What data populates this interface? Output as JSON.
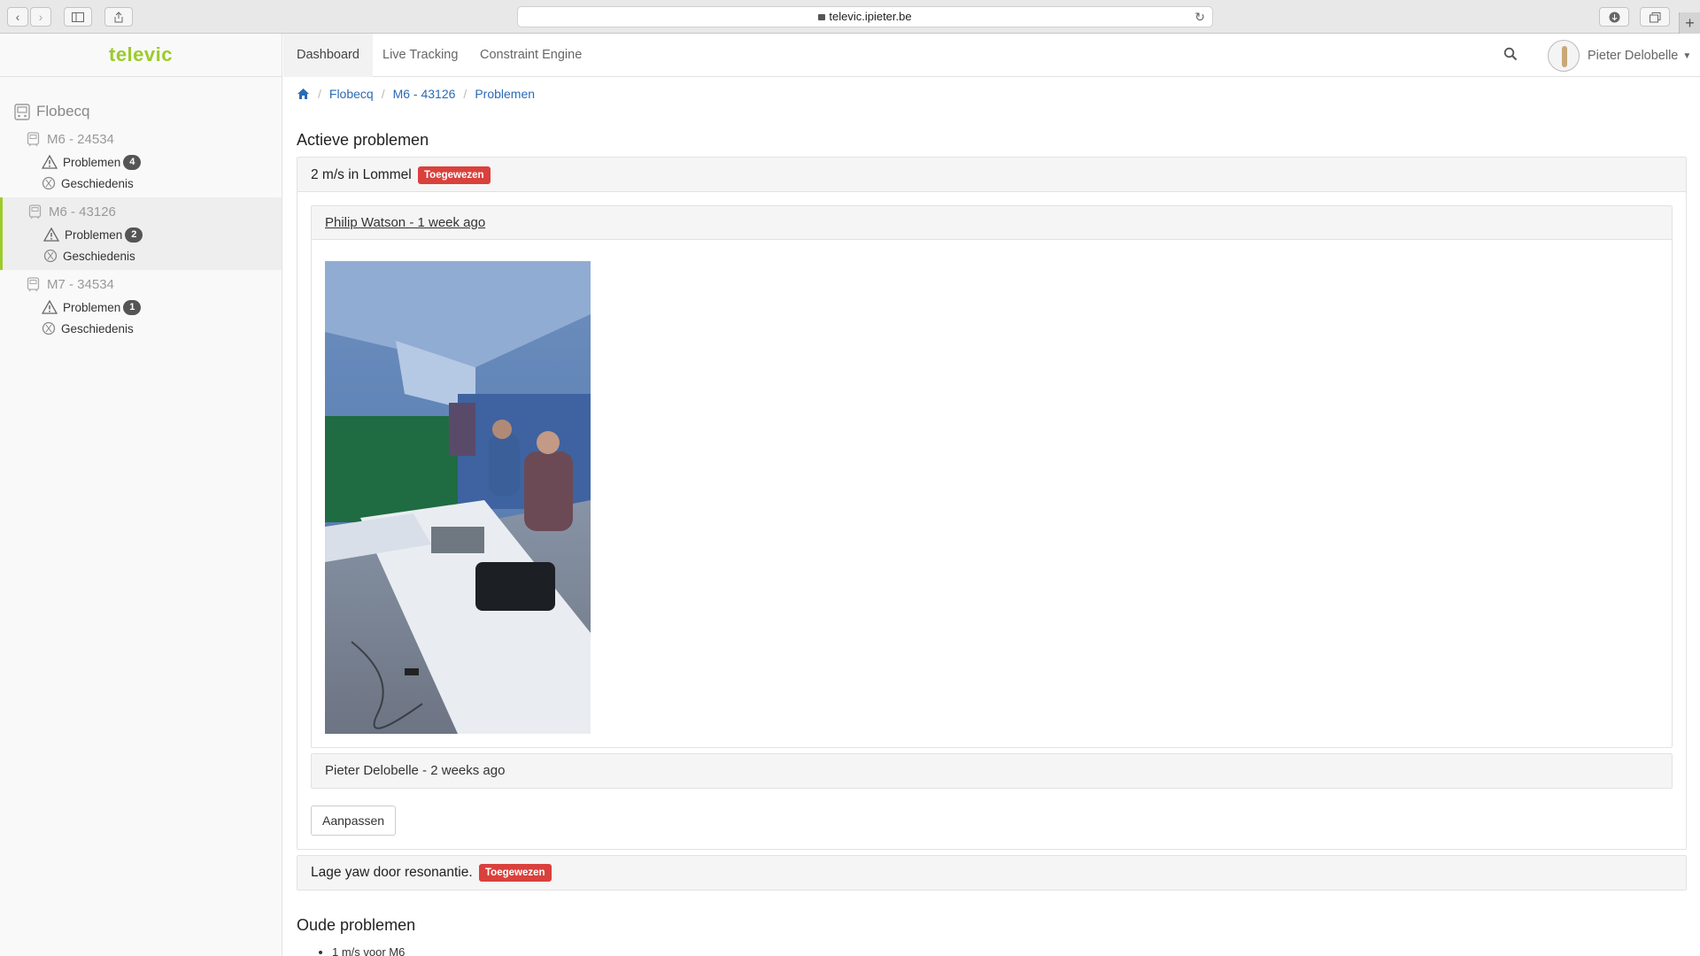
{
  "browser": {
    "url": "televic.ipieter.be"
  },
  "sidebar": {
    "brand": "televic",
    "root": "Flobecq",
    "vehicles": [
      {
        "name": "M6 - 24534",
        "problems_label": "Problemen",
        "problems_count": "4",
        "history_label": "Geschiedenis",
        "active": false
      },
      {
        "name": "M6 - 43126",
        "problems_label": "Problemen",
        "problems_count": "2",
        "history_label": "Geschiedenis",
        "active": true
      },
      {
        "name": "M7 - 34534",
        "problems_label": "Problemen",
        "problems_count": "1",
        "history_label": "Geschiedenis",
        "active": false
      }
    ]
  },
  "topnav": {
    "items": [
      "Dashboard",
      "Live Tracking",
      "Constraint Engine"
    ],
    "active": "Dashboard",
    "user_name": "Pieter Delobelle"
  },
  "breadcrumb": {
    "items": [
      "Flobecq",
      "M6 - 43126",
      "Problemen"
    ]
  },
  "active_problems": {
    "heading": "Actieve problemen",
    "problems": [
      {
        "title": "2 m/s in Lommel",
        "status": "Toegewezen",
        "comments": [
          {
            "header": "Philip Watson - 1 week ago",
            "has_photo": true
          },
          {
            "header": "Pieter Delobelle - 2 weeks ago",
            "has_photo": false
          }
        ],
        "edit_button": "Aanpassen"
      },
      {
        "title": "Lage yaw door resonantie.",
        "status": "Toegewezen"
      }
    ]
  },
  "old_problems": {
    "heading": "Oude problemen",
    "items": [
      "1 m/s voor M6"
    ]
  },
  "colors": {
    "brand": "#9ccb2a",
    "status_red": "#d9413d",
    "link": "#2a6ab5"
  }
}
